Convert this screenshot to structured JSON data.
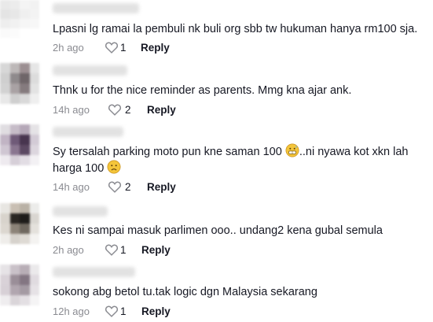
{
  "comments": [
    {
      "text": "Lpasni lg ramai la pembuli nk buli org sbb tw hukuman hanya rm100 sja.",
      "time": "2h ago",
      "likes": "1",
      "reply_label": "Reply",
      "avatar_colors": [
        "#e9e9e9",
        "#ececec",
        "#f4f4f4",
        "#f2f2f2",
        "#e4e4e4",
        "#e7e7e7",
        "#efefef",
        "#f3f3f3",
        "#eeeeee",
        "#f1f1f1",
        "#f6f6f6",
        "#f7f7f7",
        "#fafafa",
        "#fbfbfb",
        "#ffffff",
        "#ffffff"
      ]
    },
    {
      "text": "Thnk u for the nice reminder as parents. Mmg kna ajar ank.",
      "time": "14h ago",
      "likes": "2",
      "reply_label": "Reply",
      "avatar_colors": [
        "#d7d7d7",
        "#bdb8b8",
        "#9c8f92",
        "#e6e6e6",
        "#cfcfcf",
        "#8f8a8c",
        "#6f6669",
        "#dcdcdc",
        "#d2d2d2",
        "#a9a2a4",
        "#857b7e",
        "#e3e3e3",
        "#e8e8e8",
        "#cfcfcf",
        "#d9d9d9",
        "#efefef"
      ]
    },
    {
      "text": "Sy tersalah parking moto pun kne saman 100 ",
      "text2": "..ni nyawa kot xkn lah harga 100 ",
      "emoji1": "grimacing-sweat-emoji",
      "emoji2": "frowning-emoji",
      "time": "14h ago",
      "likes": "2",
      "reply_label": "Reply",
      "avatar_colors": [
        "#e0dde1",
        "#c6bcc8",
        "#b5a8b8",
        "#e5e3e6",
        "#c1b4c4",
        "#6f5a78",
        "#48354f",
        "#d3cbd6",
        "#cfc6d2",
        "#8a7690",
        "#5c4963",
        "#dcd6de",
        "#eeeaef",
        "#d6cfd8",
        "#e2dde4",
        "#f3f1f4"
      ]
    },
    {
      "text": "Kes ni sampai masuk parlimen ooo.. undang2 kena gubal semula",
      "time": "2h ago",
      "likes": "1",
      "reply_label": "Reply",
      "avatar_colors": [
        "#e8e6e2",
        "#c9bfb3",
        "#b9b1a5",
        "#ececea",
        "#d8d3cc",
        "#2a2622",
        "#1e1c1a",
        "#d9d6d1",
        "#dcd7d0",
        "#8c8378",
        "#6f685f",
        "#e4e1dc",
        "#efedea",
        "#d6d2cc",
        "#dedad4",
        "#f4f3f1"
      ]
    },
    {
      "text": "sokong abg betol tu.tak logic dgn Malaysia sekarang",
      "time": "12h ago",
      "likes": "1",
      "reply_label": "Reply",
      "avatar_colors": [
        "#e6e3e6",
        "#c9c1c8",
        "#b8aeb6",
        "#ebe9eb",
        "#d9d2d8",
        "#9a8e98",
        "#837682",
        "#e0dbe0",
        "#d7d0d6",
        "#b1a6af",
        "#a49aa3",
        "#e6e2e6",
        "#efedef",
        "#dad5d9",
        "#e3dfe3",
        "#f5f4f5"
      ]
    }
  ]
}
